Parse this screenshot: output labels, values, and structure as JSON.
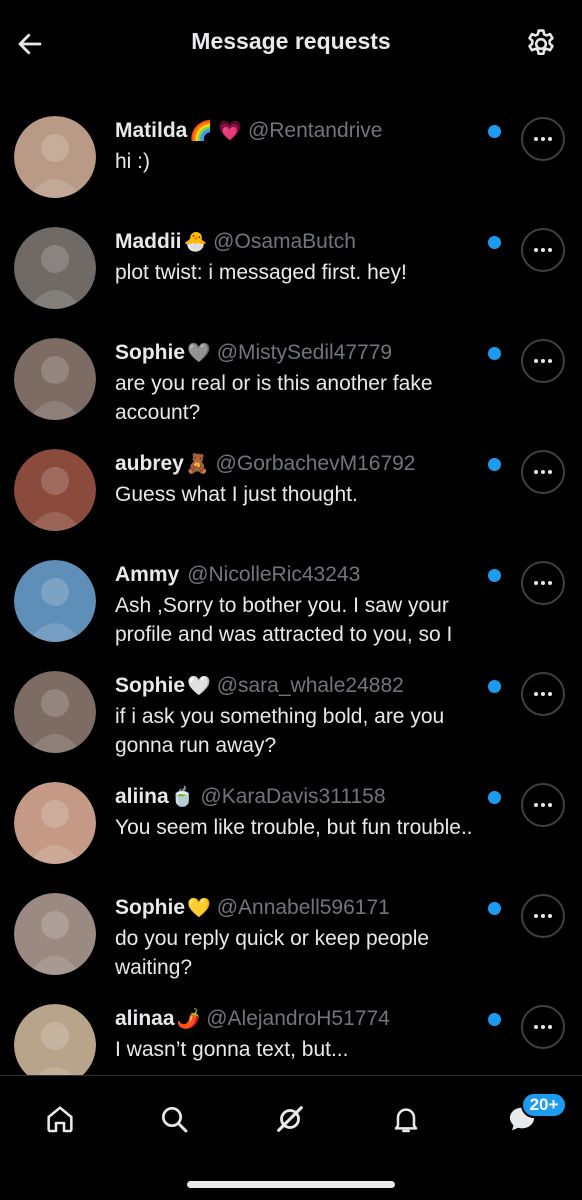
{
  "header": {
    "title": "Message requests",
    "back_icon": "arrow-left-icon",
    "settings_icon": "gear-icon"
  },
  "colors": {
    "background": "#000000",
    "text": "#e7e9ea",
    "muted": "#71767b",
    "accent": "#1d9bf0"
  },
  "requests": [
    {
      "name": "Matilda",
      "emoji": "🌈 💗",
      "handle": "@Rentandrive",
      "preview": "hi :)",
      "unread": true,
      "avatar_color": "#b99a86"
    },
    {
      "name": "Maddii",
      "emoji": "🐣",
      "handle": "@OsamaButch",
      "preview": "plot twist: i messaged first. hey!",
      "unread": true,
      "avatar_color": "#6f6a66"
    },
    {
      "name": "Sophie",
      "emoji": "🩶",
      "handle": "@MistySedil47779",
      "preview": "are you real or is this another fake account?",
      "unread": true,
      "avatar_color": "#7c6c63"
    },
    {
      "name": "aubrey",
      "emoji": "🧸",
      "handle": "@GorbachevM16792",
      "preview": "Guess what I just thought.",
      "unread": true,
      "avatar_color": "#8a4b3c"
    },
    {
      "name": "Ammy",
      "emoji": "",
      "handle": "@NicolleRic43243",
      "preview": "Ash ,Sorry to bother you. I saw your profile and was attracted to you, so I",
      "unread": true,
      "avatar_color": "#5f8fb8"
    },
    {
      "name": "Sophie",
      "emoji": "🤍",
      "handle": "@sara_whale24882",
      "preview": "if i ask you something bold, are you gonna run away?",
      "unread": true,
      "avatar_color": "#7c6c63"
    },
    {
      "name": "aliina",
      "emoji": "🍵",
      "handle": "@KaraDavis311158",
      "preview": "You seem like trouble, but fun trouble..",
      "unread": true,
      "avatar_color": "#c49a86"
    },
    {
      "name": "Sophie",
      "emoji": "💛",
      "handle": "@Annabell596171",
      "preview": "do you reply quick or keep people waiting?",
      "unread": true,
      "avatar_color": "#9a8a82"
    },
    {
      "name": "alinaa",
      "emoji": "🌶️",
      "handle": "@AlejandroH51774",
      "preview": "I wasn’t gonna text, but...",
      "unread": true,
      "avatar_color": "#b8a48a"
    }
  ],
  "bottom_nav": {
    "items": [
      "home-icon",
      "search-icon",
      "grok-icon",
      "notifications-icon",
      "messages-icon"
    ],
    "messages_badge": "20+"
  }
}
